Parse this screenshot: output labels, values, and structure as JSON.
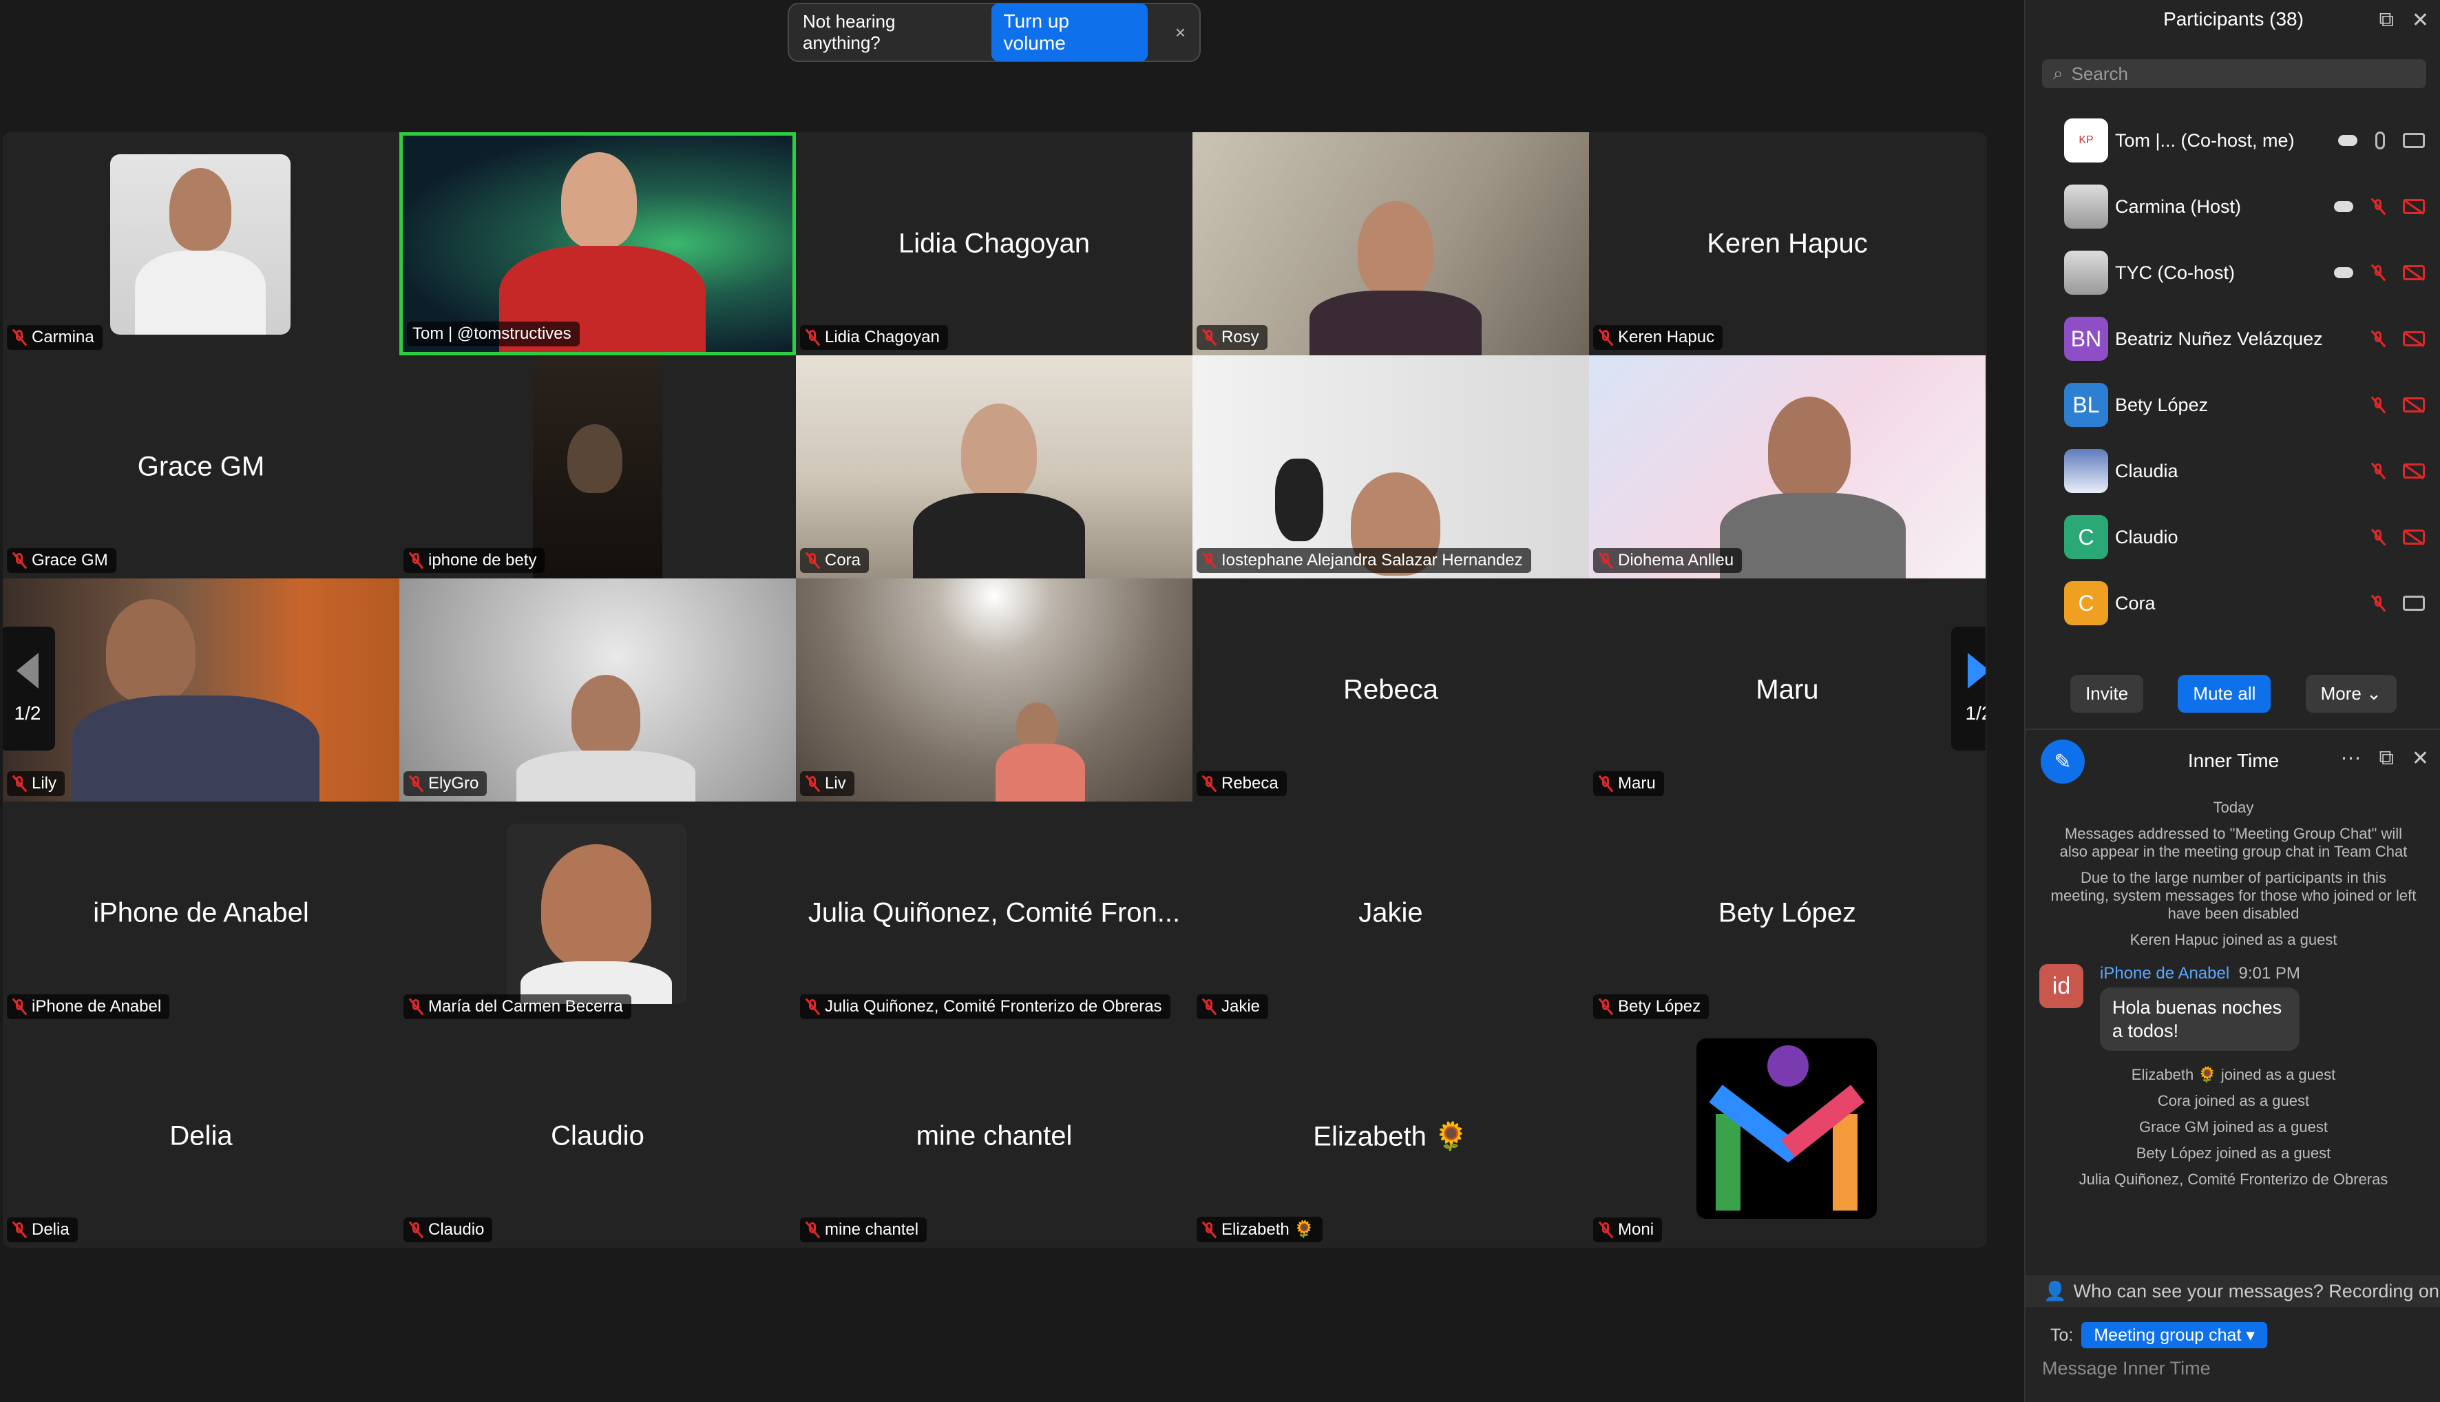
{
  "toast": {
    "text": "Not hearing anything?",
    "button": "Turn up volume",
    "close": "×"
  },
  "gallery": {
    "page_indicator": "1/2",
    "tiles": [
      {
        "name": "Carmina",
        "center": ""
      },
      {
        "name": "Tom | @tomstructives",
        "center": ""
      },
      {
        "name": "Lidia Chagoyan",
        "center": "Lidia Chagoyan"
      },
      {
        "name": "Rosy",
        "center": ""
      },
      {
        "name": "Keren Hapuc",
        "center": "Keren Hapuc"
      },
      {
        "name": "Grace GM",
        "center": "Grace GM"
      },
      {
        "name": "iphone de bety",
        "center": ""
      },
      {
        "name": "Cora",
        "center": ""
      },
      {
        "name": "Iostephane Alejandra Salazar Hernandez",
        "center": ""
      },
      {
        "name": "Diohema Anlleu",
        "center": ""
      },
      {
        "name": "Lily",
        "center": ""
      },
      {
        "name": "ElyGro",
        "center": ""
      },
      {
        "name": "Liv",
        "center": ""
      },
      {
        "name": "Rebeca",
        "center": "Rebeca"
      },
      {
        "name": "Maru",
        "center": "Maru"
      },
      {
        "name": "iPhone de Anabel",
        "center": "iPhone de Anabel"
      },
      {
        "name": "María del Carmen Becerra",
        "center": ""
      },
      {
        "name": "Julia Quiñonez, Comité Fronterizo de Obreras",
        "center": "Julia Quiñonez, Comité Fron..."
      },
      {
        "name": "Jakie",
        "center": "Jakie"
      },
      {
        "name": "Bety López",
        "center": "Bety López"
      },
      {
        "name": "Delia",
        "center": "Delia"
      },
      {
        "name": "Claudio",
        "center": "Claudio"
      },
      {
        "name": "mine chantel",
        "center": "mine chantel"
      },
      {
        "name": "Elizabeth 🌻",
        "center": "Elizabeth 🌻"
      },
      {
        "name": "Moni",
        "center": ""
      }
    ]
  },
  "participants": {
    "title": "Participants (38)",
    "search_placeholder": "Search",
    "items": [
      {
        "name": "Tom |...    (Co-host, me)",
        "initials": "",
        "color": "#ffffff"
      },
      {
        "name": "Carmina (Host)",
        "initials": "",
        "color": "#8a8a8a"
      },
      {
        "name": "TYC (Co-host)",
        "initials": "",
        "color": "#8a8a8a"
      },
      {
        "name": "Beatriz Nuñez Velázquez",
        "initials": "BN",
        "color": "#8e4ec6"
      },
      {
        "name": "Bety López",
        "initials": "BL",
        "color": "#2d7fd3"
      },
      {
        "name": "Claudia",
        "initials": "",
        "color": "#6b7ea8"
      },
      {
        "name": "Claudio",
        "initials": "C",
        "color": "#2aa876"
      },
      {
        "name": "Cora",
        "initials": "C",
        "color": "#f0a020"
      }
    ],
    "buttons": {
      "invite": "Invite",
      "mute_all": "Mute all",
      "more": "More ⌄"
    }
  },
  "chat": {
    "title": "Inner Time",
    "date": "Today",
    "system1": "Messages addressed to \"Meeting Group Chat\" will also appear in the meeting group chat in Team Chat",
    "system2": "Due to the large number of participants in this meeting, system messages for those who joined or left have been disabled",
    "joined": [
      "Keren Hapuc joined as a guest"
    ],
    "message": {
      "sender": "iPhone de Anabel",
      "time": "9:01 PM",
      "text": "Hola buenas noches a todos!",
      "avatar": "id"
    },
    "joined_after": [
      "Elizabeth 🌻 joined as a guest",
      "Cora joined as a guest",
      "Grace GM joined as a guest",
      "Bety López joined as a guest",
      "Julia Quiñonez, Comité Fronterizo de Obreras"
    ],
    "recording_notice": "Who can see your messages? Recording on",
    "to_label": "To:",
    "to_target": "Meeting group chat ▾",
    "compose_placeholder": "Message Inner Time"
  }
}
